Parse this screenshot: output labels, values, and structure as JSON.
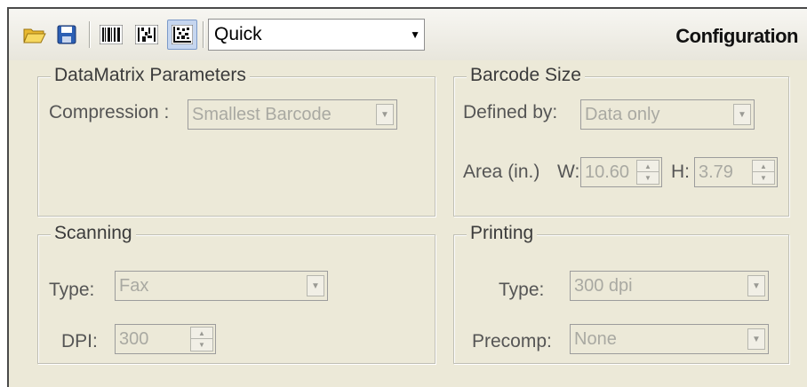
{
  "toolbar": {
    "preset_value": "Quick",
    "title": "Configuration",
    "icons": [
      "open-folder-icon",
      "save-disk-icon",
      "linear-barcode-icon",
      "stacked-barcode-icon",
      "matrix-barcode-icon"
    ]
  },
  "datamatrix": {
    "title": "DataMatrix Parameters",
    "compression_label": "Compression :",
    "compression_value": "Smallest Barcode"
  },
  "barcode_size": {
    "title": "Barcode Size",
    "defined_by_label": "Defined by:",
    "defined_by_value": "Data only",
    "area_label": "Area (in.)",
    "w_label": "W:",
    "w_value": "10.60",
    "h_label": "H:",
    "h_value": "3.79"
  },
  "scanning": {
    "title": "Scanning",
    "type_label": "Type:",
    "type_value": "Fax",
    "dpi_label": "DPI:",
    "dpi_value": "300"
  },
  "printing": {
    "title": "Printing",
    "type_label": "Type:",
    "type_value": "300 dpi",
    "precomp_label": "Precomp:",
    "precomp_value": "None"
  }
}
